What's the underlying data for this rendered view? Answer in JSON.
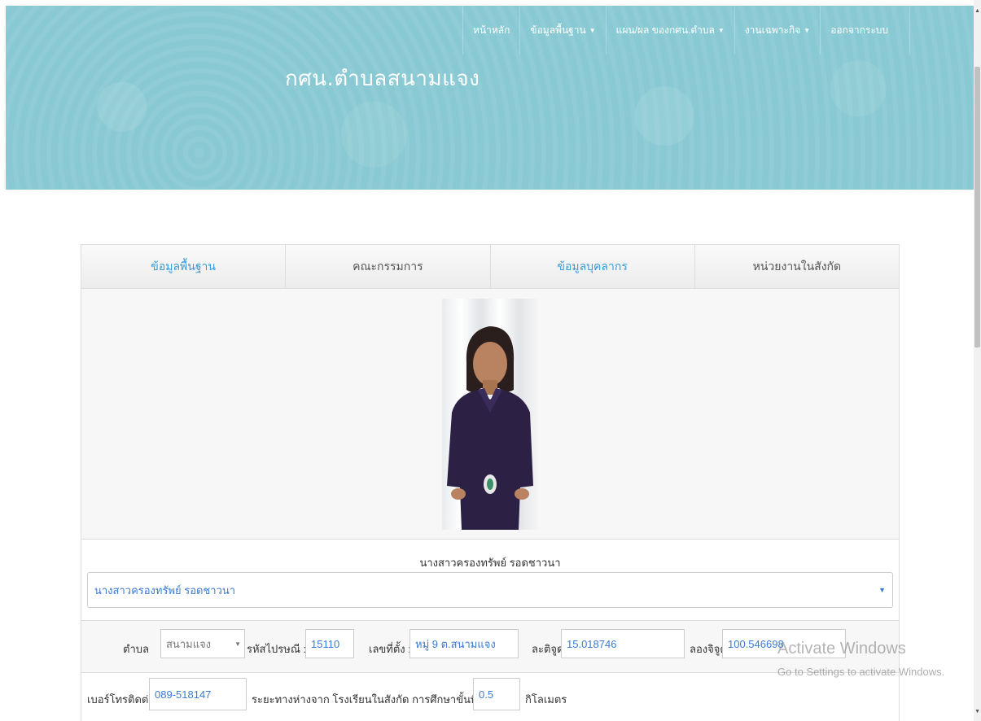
{
  "nav": {
    "items": [
      {
        "label": "หน้าหลัก",
        "dropdown": false
      },
      {
        "label": "ข้อมูลพื้นฐาน",
        "dropdown": true
      },
      {
        "label": "แผน/ผล ของกศน.ตำบล",
        "dropdown": true
      },
      {
        "label": "งานเฉพาะกิจ",
        "dropdown": true
      },
      {
        "label": "ออกจากระบบ",
        "dropdown": false
      }
    ]
  },
  "header": {
    "title": "กศน.ตำบลสนามแจง"
  },
  "tabs": [
    {
      "label": "ข้อมูลพื้นฐาน"
    },
    {
      "label": "คณะกรรมการ"
    },
    {
      "label": "ข้อมูลบุคลากร"
    },
    {
      "label": "หน่วยงานในสังกัด"
    }
  ],
  "person": {
    "caption": "นางสาวครองทรัพย์ รอดชาวนา",
    "selected": "นางสาวครองทรัพย์  รอดชาวนา"
  },
  "address": {
    "subdistrict_label": "ตำบล",
    "subdistrict_value": "สนามแจง",
    "postcode_label": "รหัสไปรษณี :",
    "postcode_value": "15110",
    "location_label": "เลขที่ตั้ง :",
    "location_value": "หมู่ 9 ต.สนามแจง",
    "latitude_label": "ละติจูด",
    "latitude_value": "15.018746",
    "longitude_label": "ลองจิจูด",
    "longitude_value": "100.546698"
  },
  "contact": {
    "phone_label": "เบอร์โทรติดต่อ",
    "phone_value": "089-518147",
    "distance_label": "ระยะทางห่างจาก โรงเรียนในสังกัด การศึกษาขั้นพื้นฐาน",
    "distance_value": "0.5",
    "distance_unit": "กิโลเมตร"
  },
  "watermark": {
    "line1": "Activate Windows",
    "line2": "Go to Settings to activate Windows."
  },
  "colors": {
    "banner": "#89c9d3",
    "link": "#3a9bd5",
    "field_text": "#3a7bd5"
  }
}
